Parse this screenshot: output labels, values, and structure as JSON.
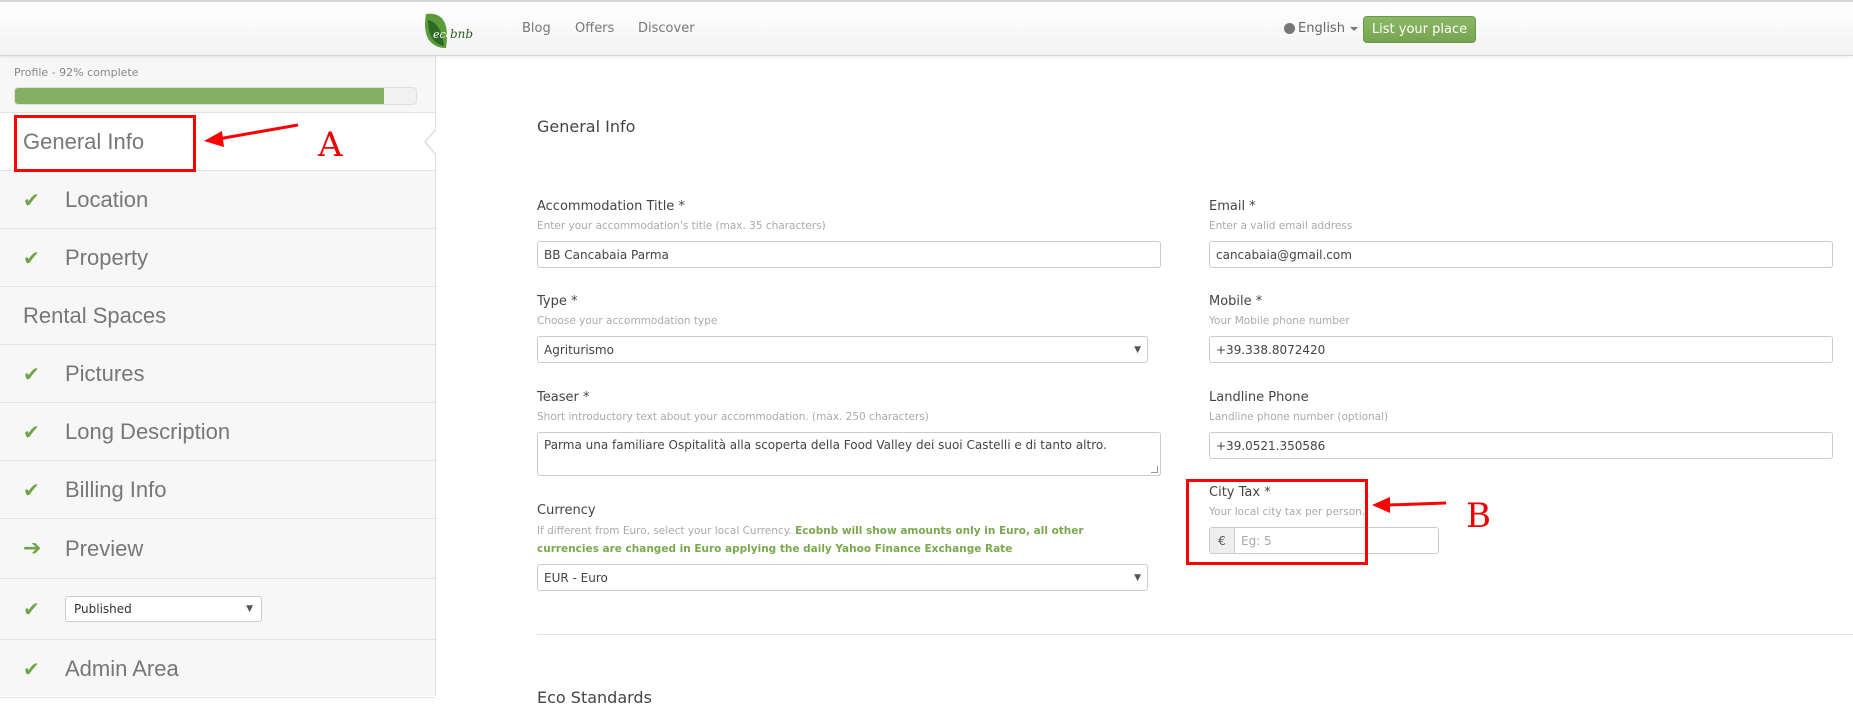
{
  "header": {
    "logo_alt": "ecobnb",
    "nav": [
      "Blog",
      "Offers",
      "Discover"
    ],
    "language": "English",
    "cta": "List your place"
  },
  "sidebar": {
    "progress_label": "Profile - 92% complete",
    "progress_percent": 92,
    "items": [
      {
        "label": "General Info",
        "icon": "none",
        "active": true
      },
      {
        "label": "Location",
        "icon": "check-icon"
      },
      {
        "label": "Property",
        "icon": "check-icon"
      },
      {
        "label": "Rental Spaces",
        "icon": "none"
      },
      {
        "label": "Pictures",
        "icon": "check-icon"
      },
      {
        "label": "Long Description",
        "icon": "check-icon"
      },
      {
        "label": "Billing Info",
        "icon": "check-icon"
      },
      {
        "label": "Preview",
        "icon": "arrow-right-icon"
      },
      {
        "label": "Published",
        "icon": "check-icon",
        "type": "select"
      },
      {
        "label": "Admin Area",
        "icon": "check-icon"
      }
    ],
    "status_select": "Published"
  },
  "main": {
    "section_title": "General Info",
    "fields": {
      "title": {
        "label": "Accommodation Title *",
        "help": "Enter your accommodation's title (max. 35 characters)",
        "value": "BB Cancabaia Parma"
      },
      "type": {
        "label": "Type *",
        "help": "Choose your accommodation type",
        "value": "Agriturismo"
      },
      "teaser": {
        "label": "Teaser *",
        "help": "Short introductory text about your accommodation. (max. 250 characters)",
        "value": "Parma una familiare Ospitalità alla scoperta della Food Valley dei suoi Castelli e di tanto altro."
      },
      "currency": {
        "label": "Currency",
        "help": "If different from Euro, select your local Currency.",
        "help_highlight": "Ecobnb will show amounts only in Euro, all other currencies are changed in Euro applying the daily Yahoo Finance Exchange Rate",
        "value": "EUR - Euro"
      },
      "email": {
        "label": "Email *",
        "help": "Enter a valid email address",
        "value": "cancabaia@gmail.com"
      },
      "mobile": {
        "label": "Mobile *",
        "help": "Your Mobile phone number",
        "value": "+39.338.8072420"
      },
      "landline": {
        "label": "Landline Phone",
        "help": "Landline phone number (optional)",
        "value": "+39.0521.350586"
      },
      "city_tax": {
        "label": "City Tax *",
        "help": "Your local city tax per person.",
        "currency_symbol": "€",
        "placeholder": "Eg: 5",
        "value": ""
      }
    },
    "next_section_title": "Eco Standards"
  },
  "annotations": {
    "a": "A",
    "b": "B",
    "color": "#ff0000"
  },
  "colors": {
    "accent_green": "#84b062",
    "check_green": "#6ea547"
  }
}
